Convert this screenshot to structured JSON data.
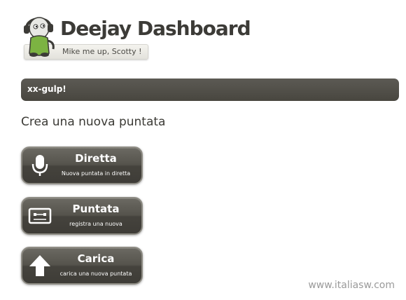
{
  "header": {
    "app_title": "Deejay Dashboard",
    "tagline": "Mike me up, Scotty !"
  },
  "user_bar": {
    "username": "xx-gulp!"
  },
  "main": {
    "section_heading": "Crea una nuova puntata",
    "actions": [
      {
        "label": "Diretta",
        "sublabel": "Nuova puntata in diretta",
        "icon": "microphone-icon"
      },
      {
        "label": "Puntata",
        "sublabel": "registra una nuova",
        "icon": "cassette-icon"
      },
      {
        "label": "Carica",
        "sublabel": "carica una nuova puntata",
        "icon": "upload-arrow-icon"
      }
    ]
  },
  "watermark": "www.italiasw.com"
}
